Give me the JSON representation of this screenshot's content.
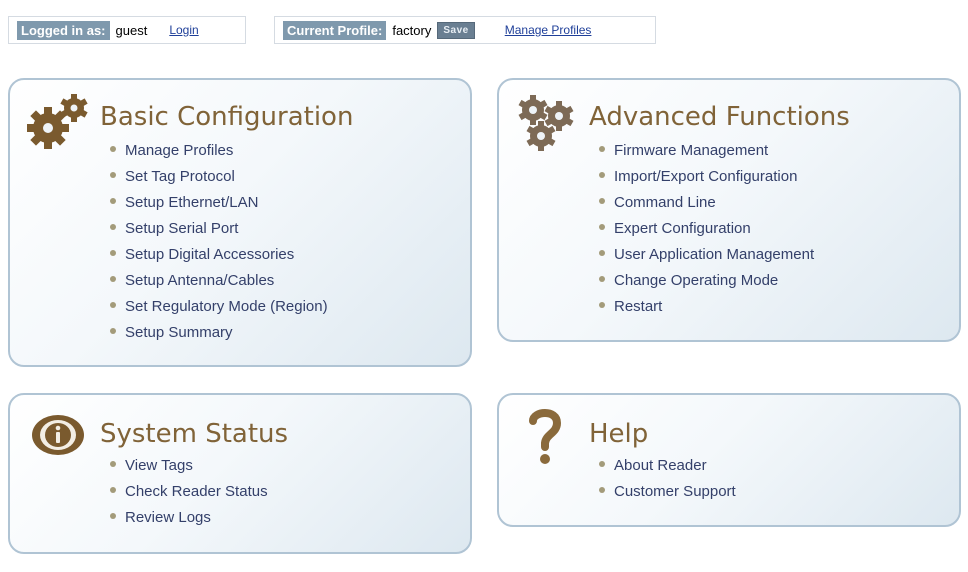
{
  "header": {
    "login_label": "Logged in as:",
    "username": "guest",
    "login_link": "Login",
    "profile_label": "Current Profile:",
    "profile_name": "factory",
    "save_label": "Save",
    "manage_profiles_link": "Manage Profiles"
  },
  "panels": {
    "basic": {
      "title": "Basic Configuration",
      "icon": "gears-icon",
      "items": [
        "Manage Profiles",
        "Set Tag Protocol",
        "Setup Ethernet/LAN",
        "Setup Serial Port",
        "Setup Digital Accessories",
        "Setup Antenna/Cables",
        "Set Regulatory Mode (Region)",
        "Setup Summary"
      ]
    },
    "advanced": {
      "title": "Advanced Functions",
      "icon": "gears-cluster-icon",
      "items": [
        "Firmware Management",
        "Import/Export Configuration",
        "Command Line",
        "Expert Configuration",
        "User Application Management",
        "Change Operating Mode",
        "Restart"
      ]
    },
    "status": {
      "title": "System Status",
      "icon": "info-icon",
      "items": [
        "View Tags",
        "Check Reader Status",
        "Review Logs"
      ]
    },
    "help": {
      "title": "Help",
      "icon": "question-mark-icon",
      "items": [
        "About Reader",
        "Customer Support"
      ]
    }
  },
  "colors": {
    "title": "#806338",
    "link": "#34406a",
    "panel_border": "#b0c4d4",
    "header_tag": "#7f99ad"
  }
}
